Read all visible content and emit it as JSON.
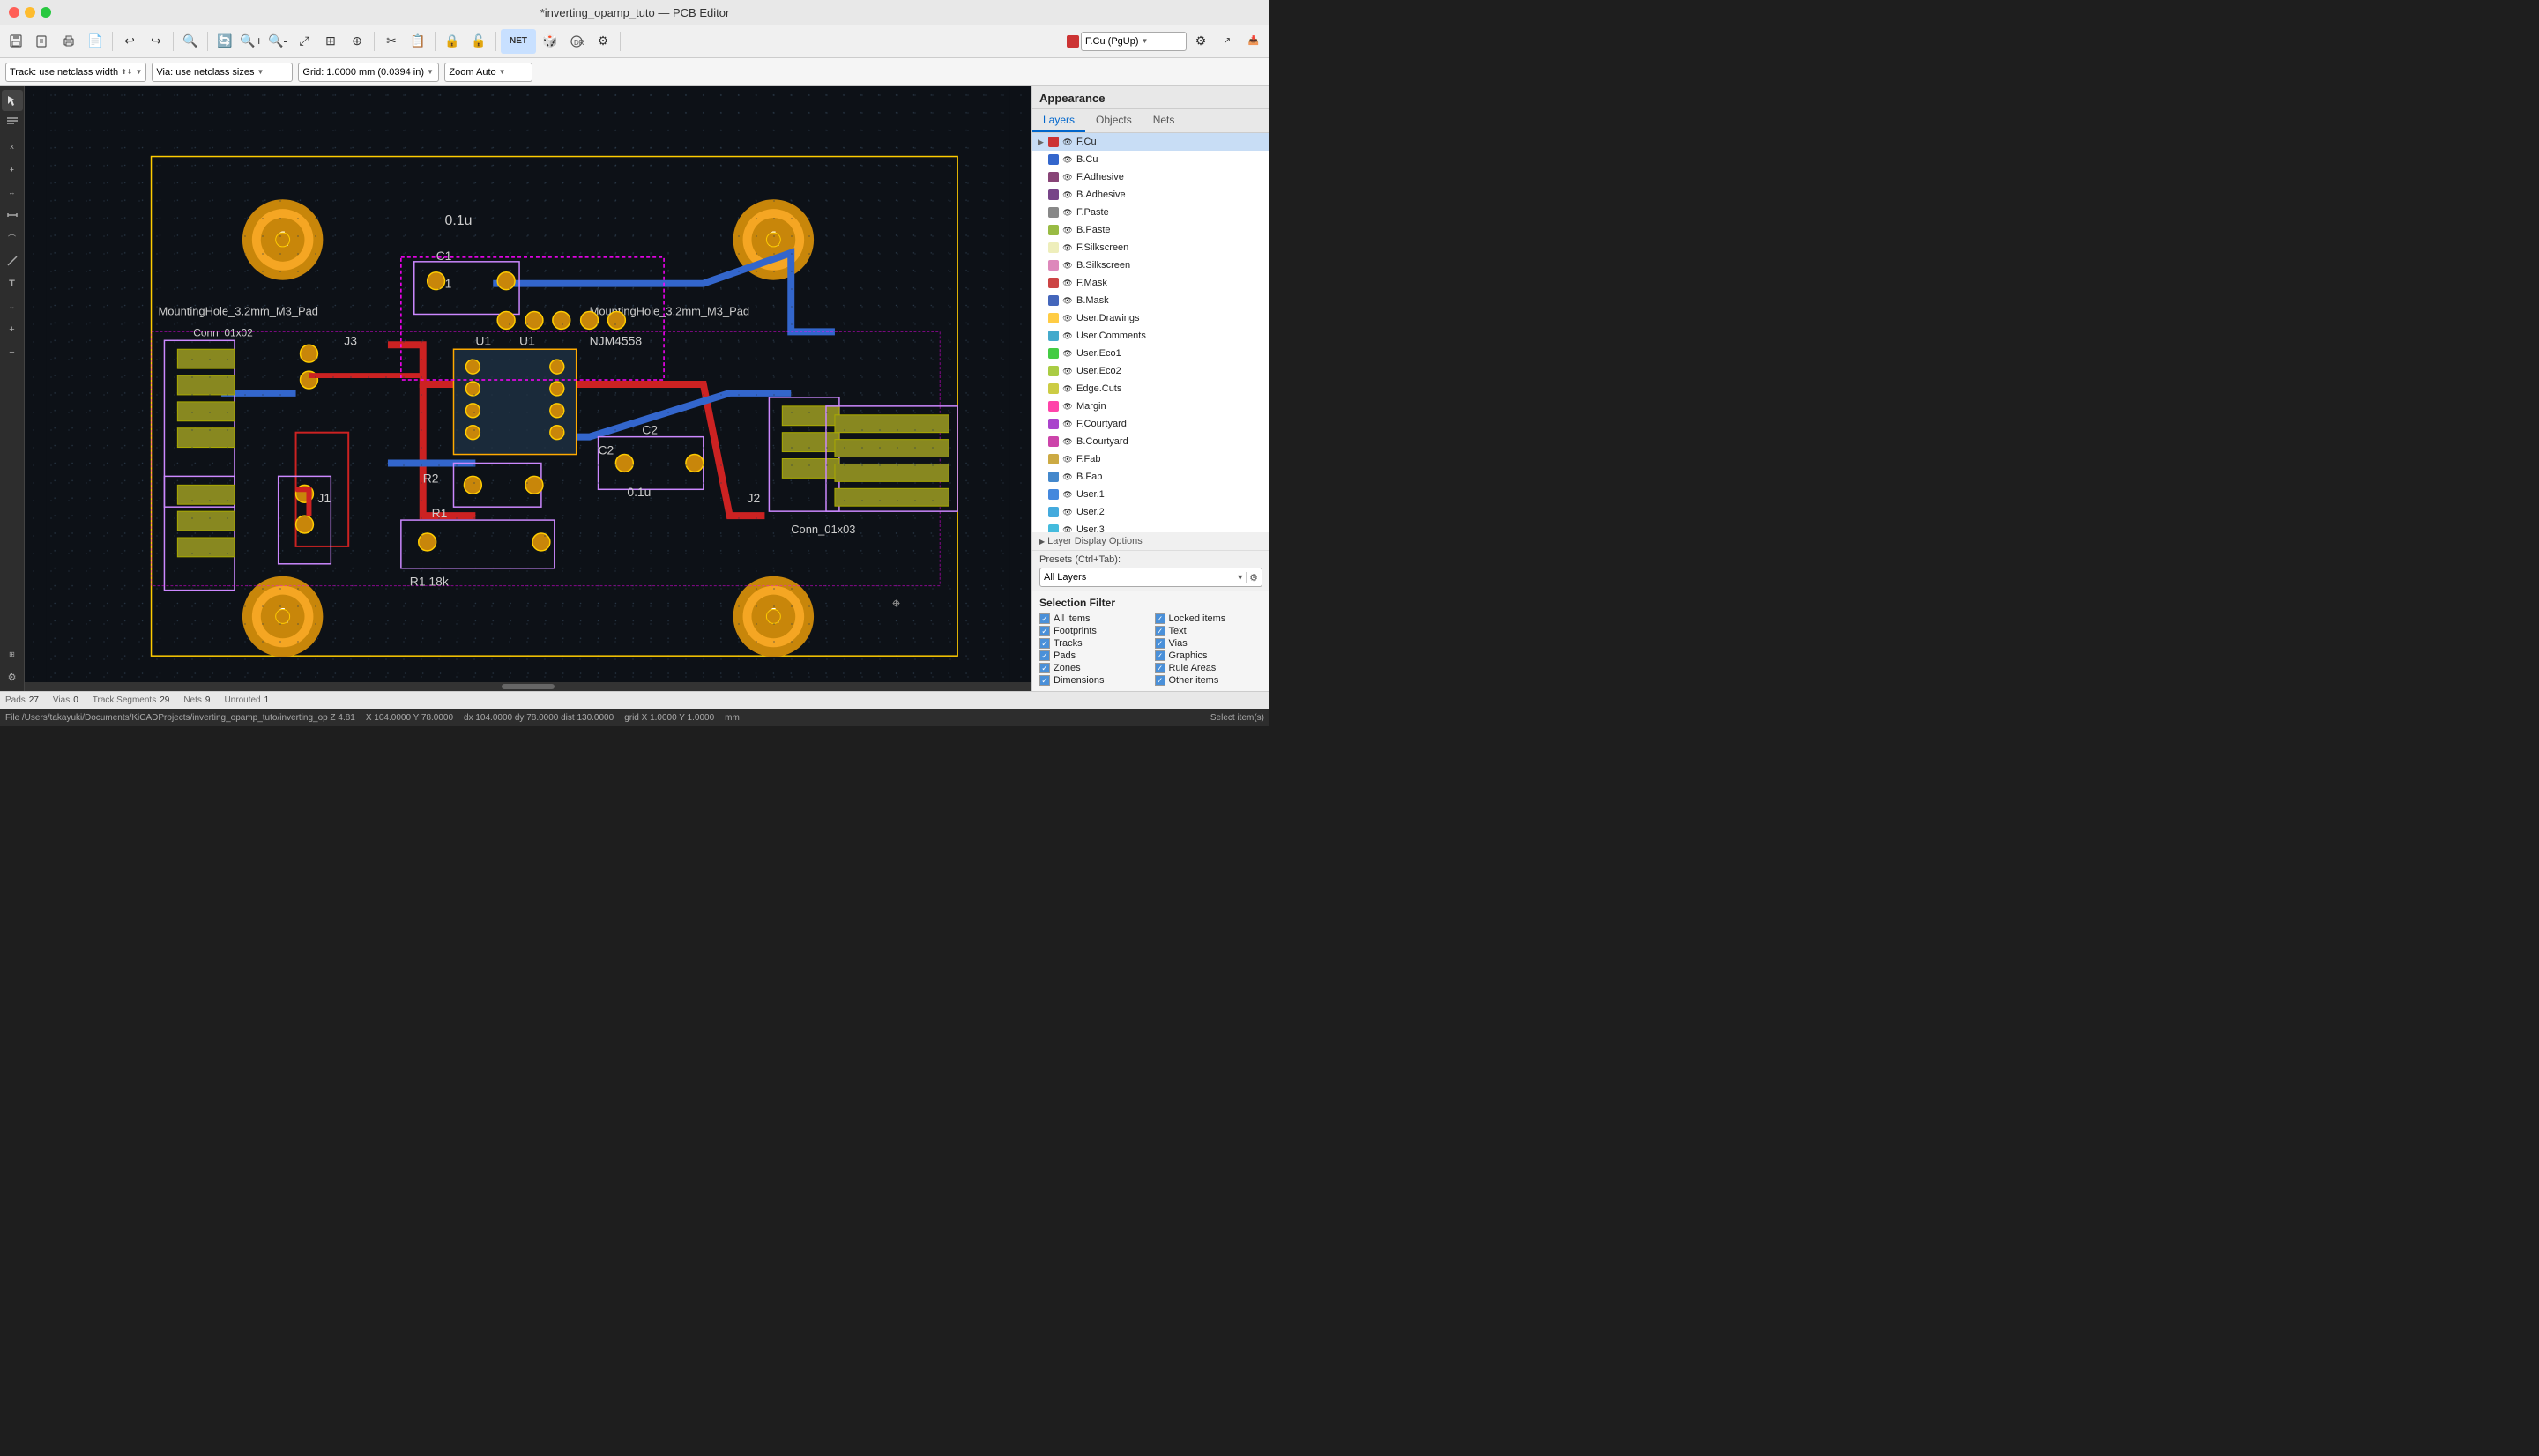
{
  "titlebar": {
    "title": "*inverting_opamp_tuto — PCB Editor"
  },
  "toolbar": {
    "buttons": [
      "💾",
      "📋",
      "🖨",
      "🖥",
      "↩",
      "↪",
      "🔍",
      "🔄",
      "🔍+",
      "🔍-",
      "🔎",
      "⊕",
      "⊖",
      "⤢",
      "⟲",
      "✂",
      "📋",
      "📌",
      "🔒",
      "🔓",
      "🎯",
      "🎲",
      "⚙",
      "⚡",
      "✦"
    ]
  },
  "optionsbar": {
    "track_label": "Track: use netclass width",
    "via_label": "Via: use netclass sizes",
    "grid_label": "Grid: 1.0000 mm (0.0394 in)",
    "zoom_label": "Zoom Auto",
    "layer_label": "F.Cu (PgUp)"
  },
  "appearance": {
    "title": "Appearance",
    "tabs": [
      "Layers",
      "Objects",
      "Nets"
    ],
    "active_tab": "Layers",
    "layers": [
      {
        "name": "F.Cu",
        "color": "#cc3333",
        "visible": true,
        "selected": true,
        "arrow": true
      },
      {
        "name": "B.Cu",
        "color": "#3366cc",
        "visible": true,
        "selected": false,
        "arrow": false
      },
      {
        "name": "F.Adhesive",
        "color": "#884477",
        "visible": true,
        "selected": false,
        "arrow": false
      },
      {
        "name": "B.Adhesive",
        "color": "#774488",
        "visible": true,
        "selected": false,
        "arrow": false
      },
      {
        "name": "F.Paste",
        "color": "#888888",
        "visible": true,
        "selected": false,
        "arrow": false
      },
      {
        "name": "B.Paste",
        "color": "#99bb44",
        "visible": true,
        "selected": false,
        "arrow": false
      },
      {
        "name": "F.Silkscreen",
        "color": "#eeeebb",
        "visible": true,
        "selected": false,
        "arrow": false
      },
      {
        "name": "B.Silkscreen",
        "color": "#dd88bb",
        "visible": true,
        "selected": false,
        "arrow": false
      },
      {
        "name": "F.Mask",
        "color": "#cc4444",
        "visible": true,
        "selected": false,
        "arrow": false
      },
      {
        "name": "B.Mask",
        "color": "#4466bb",
        "visible": true,
        "selected": false,
        "arrow": false
      },
      {
        "name": "User.Drawings",
        "color": "#ffcc44",
        "visible": true,
        "selected": false,
        "arrow": false
      },
      {
        "name": "User.Comments",
        "color": "#44aacc",
        "visible": true,
        "selected": false,
        "arrow": false
      },
      {
        "name": "User.Eco1",
        "color": "#44cc44",
        "visible": true,
        "selected": false,
        "arrow": false
      },
      {
        "name": "User.Eco2",
        "color": "#aacc44",
        "visible": true,
        "selected": false,
        "arrow": false
      },
      {
        "name": "Edge.Cuts",
        "color": "#cccc44",
        "visible": true,
        "selected": false,
        "arrow": false
      },
      {
        "name": "Margin",
        "color": "#ff44aa",
        "visible": true,
        "selected": false,
        "arrow": false
      },
      {
        "name": "F.Courtyard",
        "color": "#aa44cc",
        "visible": true,
        "selected": false,
        "arrow": false
      },
      {
        "name": "B.Courtyard",
        "color": "#cc44aa",
        "visible": true,
        "selected": false,
        "arrow": false
      },
      {
        "name": "F.Fab",
        "color": "#ccaa44",
        "visible": true,
        "selected": false,
        "arrow": false
      },
      {
        "name": "B.Fab",
        "color": "#4488cc",
        "visible": true,
        "selected": false,
        "arrow": false
      },
      {
        "name": "User.1",
        "color": "#4488dd",
        "visible": true,
        "selected": false,
        "arrow": false
      },
      {
        "name": "User.2",
        "color": "#44aadd",
        "visible": true,
        "selected": false,
        "arrow": false
      },
      {
        "name": "User.3",
        "color": "#44bbdd",
        "visible": true,
        "selected": false,
        "arrow": false
      }
    ],
    "layer_display_opts": "Layer Display Options",
    "presets_label": "Presets (Ctrl+Tab):",
    "presets_value": "All Layers"
  },
  "selection_filter": {
    "title": "Selection Filter",
    "items": [
      {
        "label": "All items",
        "checked": true
      },
      {
        "label": "Locked items",
        "checked": true
      },
      {
        "label": "Footprints",
        "checked": true
      },
      {
        "label": "Text",
        "checked": true
      },
      {
        "label": "Tracks",
        "checked": true
      },
      {
        "label": "Vias",
        "checked": true
      },
      {
        "label": "Pads",
        "checked": true
      },
      {
        "label": "Graphics",
        "checked": true
      },
      {
        "label": "Zones",
        "checked": true
      },
      {
        "label": "Rule Areas",
        "checked": true
      },
      {
        "label": "Dimensions",
        "checked": true
      },
      {
        "label": "Other items",
        "checked": true
      }
    ]
  },
  "statusbar": {
    "pads_label": "Pads",
    "pads_val": "27",
    "vias_label": "Vias",
    "vias_val": "0",
    "track_label": "Track Segments",
    "track_val": "29",
    "nets_label": "Nets",
    "nets_val": "9",
    "unrouted_label": "Unrouted",
    "unrouted_val": "1"
  },
  "infobar": {
    "file": "File /Users/takayuki/Documents/KiCADProjects/inverting_opamp_tuto/inverting_op  Z 4.81",
    "coords": "X 104.0000  Y 78.0000",
    "delta": "dx 104.0000  dy 78.0000  dist 130.0000",
    "grid": "grid X 1.0000  Y 1.0000",
    "units": "mm",
    "mode": "Select item(s)"
  },
  "left_tools": {
    "icons": [
      "⊹",
      "⊞",
      "⊟",
      "⊠",
      "⊡",
      "┼",
      "⊢",
      "⊣",
      "⊤",
      "⊥",
      "⊦",
      "⊧",
      "⊨",
      "⊩",
      "⊪",
      "⊫",
      "⊬",
      "⊭",
      "⊮",
      "⊯",
      "⊰",
      "⊱"
    ]
  }
}
